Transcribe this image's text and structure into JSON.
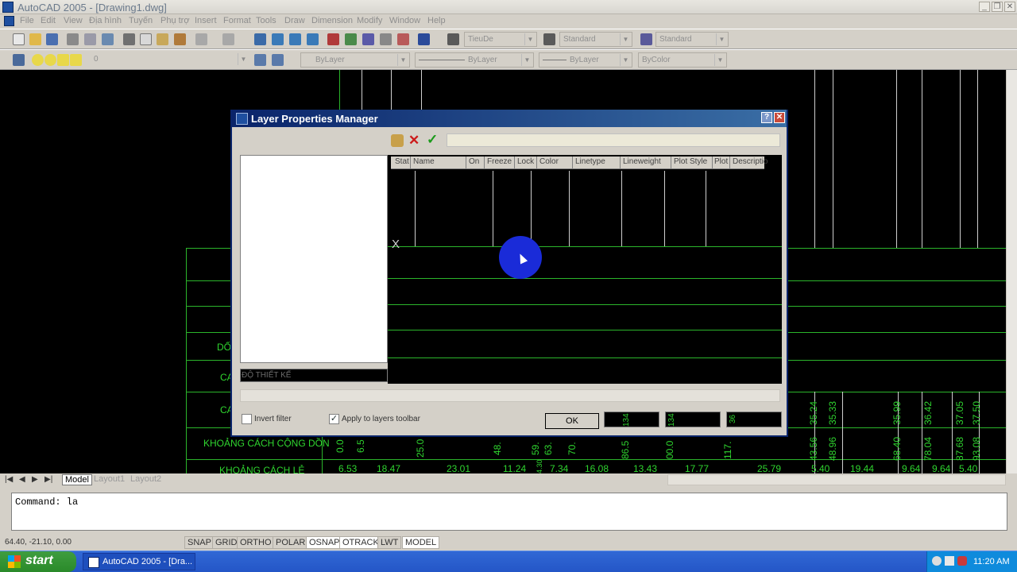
{
  "window": {
    "title": "AutoCAD 2005 - [Drawing1.dwg]"
  },
  "menu": [
    "File",
    "Edit",
    "View",
    "Địa hình",
    "Tuyến",
    "Phụ trợ",
    "Insert",
    "Format",
    "Tools",
    "Draw",
    "Dimension",
    "Modify",
    "Window",
    "Help"
  ],
  "toolbar": {
    "text_style": "TieuDe",
    "dim_style": "Standard",
    "table_style": "Standard",
    "layer_current": "0",
    "color": "ByLayer",
    "linetype": "ByLayer",
    "lineweight": "ByLayer",
    "plotstyle": "ByColor"
  },
  "drawing": {
    "row_labels": [
      "DỐC",
      "CA",
      "CA",
      "KHOẢNG CÁCH CỘNG DỒN",
      "KHOẢNG CÁCH LẺ"
    ],
    "cumulative": [
      "0.0",
      "6.5",
      "25.0",
      "48.",
      "59.",
      "63.",
      "70.",
      "86.5",
      "00.0",
      "117.",
      "43.56",
      "48.96",
      "68.40",
      "78.04",
      "87.68",
      "93.08"
    ],
    "elevations": [
      "35.24",
      "35.33",
      "35.99",
      "36.42",
      "37.05",
      "37.50"
    ],
    "distances": [
      "6.53",
      "18.47",
      "23.01",
      "11.24",
      "7.34",
      "16.08",
      "13.43",
      "17.77",
      "25.79",
      "5.40",
      "19.44",
      "9.64",
      "9.64",
      "5.40"
    ],
    "small": [
      "4.30"
    ],
    "marker": "X"
  },
  "dialog": {
    "title": "Layer Properties Manager",
    "help_glyph": "?",
    "close_glyph": "✕",
    "columns": [
      "Stat",
      "Name",
      "On",
      "Freeze",
      "Lock",
      "Color",
      "Linetype",
      "Lineweight",
      "Plot Style",
      "Plot",
      "Descriptio"
    ],
    "filter_name": "ĐỘ THIẾT KẾ",
    "invert_filter_label": "Invert filter",
    "invert_filter_checked": false,
    "apply_toolbar_label": "Apply to layers toolbar",
    "apply_toolbar_checked": true,
    "ok_label": "OK",
    "dark_btn_labels": [
      "134",
      "134",
      "36"
    ]
  },
  "tabs": [
    "Model",
    "Layout1",
    "Layout2"
  ],
  "command_line": "Command: la",
  "status": {
    "coords": "64.40, -21.10, 0.00",
    "toggles": [
      "SNAP",
      "GRID",
      "ORTHO",
      "POLAR",
      "OSNAP",
      "OTRACK",
      "LWT",
      "MODEL"
    ]
  },
  "taskbar": {
    "start_label": "start",
    "task_label": "AutoCAD 2005 - [Dra...",
    "clock": "11:20 AM"
  },
  "colors": {
    "drawing_green": "#2fd52f",
    "dialog_title": "#0a246a",
    "taskbar": "#2456c7"
  }
}
